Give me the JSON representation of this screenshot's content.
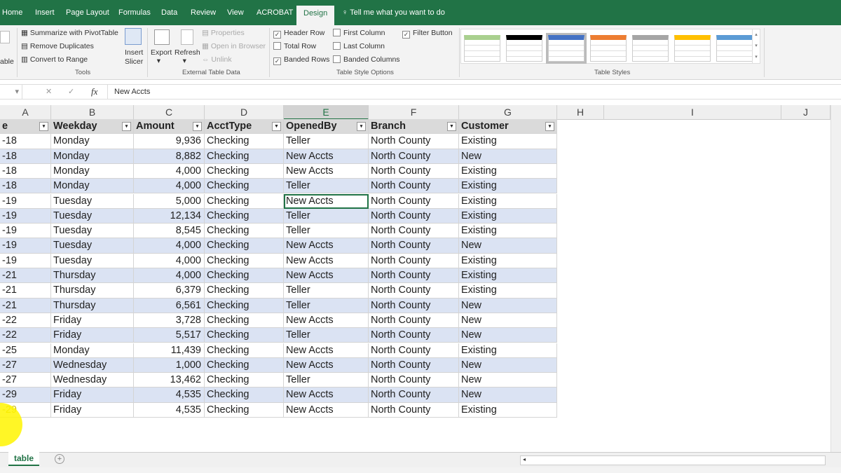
{
  "tabs": [
    "Home",
    "Insert",
    "Page Layout",
    "Formulas",
    "Data",
    "Review",
    "View",
    "ACROBAT",
    "Design"
  ],
  "tell_me": "Tell me what you want to do",
  "ribbon": {
    "partial_left": "able",
    "tools": [
      "Summarize with PivotTable",
      "Remove Duplicates",
      "Convert to Range"
    ],
    "tools_group": "Tools",
    "insert_slicer": [
      "Insert",
      "Slicer"
    ],
    "export": "Export",
    "refresh": "Refresh",
    "ext": [
      "Properties",
      "Open in Browser",
      "Unlink"
    ],
    "ext_group": "External Table Data",
    "options": [
      {
        "label": "Header Row",
        "checked": true
      },
      {
        "label": "Total Row",
        "checked": false
      },
      {
        "label": "Banded Rows",
        "checked": true
      },
      {
        "label": "First Column",
        "checked": false
      },
      {
        "label": "Last Column",
        "checked": false
      },
      {
        "label": "Banded Columns",
        "checked": false
      },
      {
        "label": "Filter Button",
        "checked": true
      }
    ],
    "options_group": "Table Style Options",
    "styles_group": "Table Styles",
    "style_colors": [
      "#a9d08e",
      "#000000",
      "#4472c4",
      "#ed7d31",
      "#a5a5a5",
      "#ffc000",
      "#5b9bd5"
    ]
  },
  "formula": {
    "value": "New Accts"
  },
  "columns": [
    "A",
    "B",
    "C",
    "D",
    "E",
    "F",
    "G",
    "H",
    "I",
    "J"
  ],
  "headers": [
    "e",
    "Weekday",
    "Amount",
    "AcctType",
    "OpenedBy",
    "Branch",
    "Customer"
  ],
  "rows": [
    [
      "-18",
      "Monday",
      "9,936",
      "Checking",
      "Teller",
      "North County",
      "Existing"
    ],
    [
      "-18",
      "Monday",
      "8,882",
      "Checking",
      "New Accts",
      "North County",
      "New"
    ],
    [
      "-18",
      "Monday",
      "4,000",
      "Checking",
      "New Accts",
      "North County",
      "Existing"
    ],
    [
      "-18",
      "Monday",
      "4,000",
      "Checking",
      "Teller",
      "North County",
      "Existing"
    ],
    [
      "-19",
      "Tuesday",
      "5,000",
      "Checking",
      "New Accts",
      "North County",
      "Existing"
    ],
    [
      "-19",
      "Tuesday",
      "12,134",
      "Checking",
      "Teller",
      "North County",
      "Existing"
    ],
    [
      "-19",
      "Tuesday",
      "8,545",
      "Checking",
      "Teller",
      "North County",
      "Existing"
    ],
    [
      "-19",
      "Tuesday",
      "4,000",
      "Checking",
      "New Accts",
      "North County",
      "New"
    ],
    [
      "-19",
      "Tuesday",
      "4,000",
      "Checking",
      "New Accts",
      "North County",
      "Existing"
    ],
    [
      "-21",
      "Thursday",
      "4,000",
      "Checking",
      "New Accts",
      "North County",
      "Existing"
    ],
    [
      "-21",
      "Thursday",
      "6,379",
      "Checking",
      "Teller",
      "North County",
      "Existing"
    ],
    [
      "-21",
      "Thursday",
      "6,561",
      "Checking",
      "Teller",
      "North County",
      "New"
    ],
    [
      "-22",
      "Friday",
      "3,728",
      "Checking",
      "New Accts",
      "North County",
      "New"
    ],
    [
      "-22",
      "Friday",
      "5,517",
      "Checking",
      "Teller",
      "North County",
      "New"
    ],
    [
      "-25",
      "Monday",
      "11,439",
      "Checking",
      "New Accts",
      "North County",
      "Existing"
    ],
    [
      "-27",
      "Wednesday",
      "1,000",
      "Checking",
      "New Accts",
      "North County",
      "New"
    ],
    [
      "-27",
      "Wednesday",
      "13,462",
      "Checking",
      "Teller",
      "North County",
      "New"
    ],
    [
      "-29",
      "Friday",
      "4,535",
      "Checking",
      "New Accts",
      "North County",
      "New"
    ],
    [
      "-29",
      "Friday",
      "4,535",
      "Checking",
      "New Accts",
      "North County",
      "Existing"
    ]
  ],
  "sheet_tab": "table"
}
